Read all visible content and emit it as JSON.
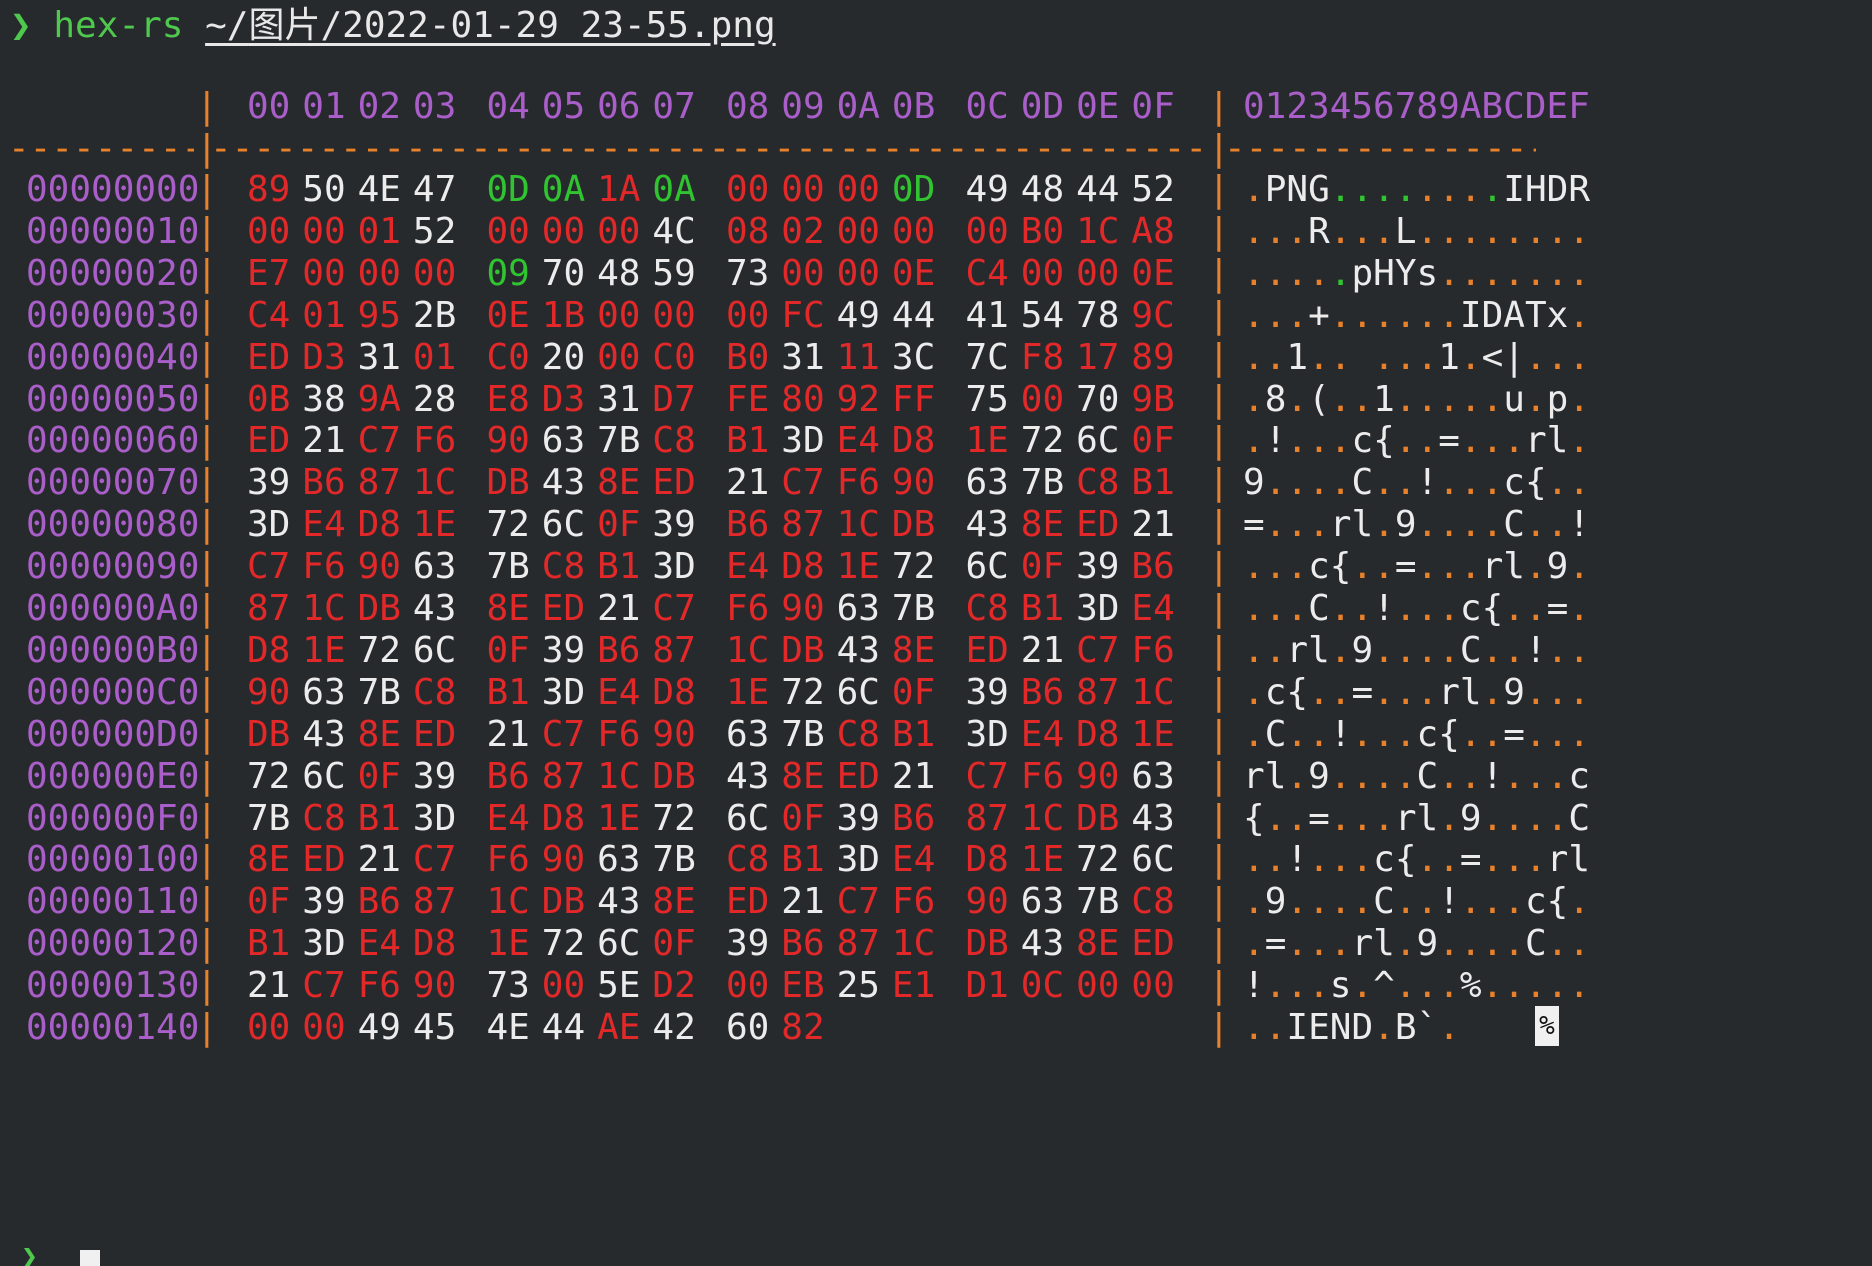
{
  "prompt": {
    "arrow": "❯",
    "command": "hex-rs",
    "path_prefix": "~/",
    "path_dir": "图片",
    "path_file": "/2022-01-29_23-55.png"
  },
  "header": {
    "columns": [
      "00",
      "01",
      "02",
      "03",
      "04",
      "05",
      "06",
      "07",
      "08",
      "09",
      "0A",
      "0B",
      "0C",
      "0D",
      "0E",
      "0F"
    ],
    "ascii_header": "0123456789ABCDEF",
    "separator": "|"
  },
  "dash_row": {
    "offset_dashes": "----------",
    "hex_dashes": "-------------------------------------------------------------------",
    "ascii_dashes": "-----------------"
  },
  "rows": [
    {
      "offset": "00000000",
      "bytes": [
        "89",
        "50",
        "4E",
        "47",
        "0D",
        "0A",
        "1A",
        "0A",
        "00",
        "00",
        "00",
        "0D",
        "49",
        "48",
        "44",
        "52"
      ],
      "ascii": ".PNG........IHDR"
    },
    {
      "offset": "00000010",
      "bytes": [
        "00",
        "00",
        "01",
        "52",
        "00",
        "00",
        "00",
        "4C",
        "08",
        "02",
        "00",
        "00",
        "00",
        "B0",
        "1C",
        "A8"
      ],
      "ascii": "...R...L........"
    },
    {
      "offset": "00000020",
      "bytes": [
        "E7",
        "00",
        "00",
        "00",
        "09",
        "70",
        "48",
        "59",
        "73",
        "00",
        "00",
        "0E",
        "C4",
        "00",
        "00",
        "0E"
      ],
      "ascii": ".....pHYs......."
    },
    {
      "offset": "00000030",
      "bytes": [
        "C4",
        "01",
        "95",
        "2B",
        "0E",
        "1B",
        "00",
        "00",
        "00",
        "FC",
        "49",
        "44",
        "41",
        "54",
        "78",
        "9C"
      ],
      "ascii": "...+......IDATx."
    },
    {
      "offset": "00000040",
      "bytes": [
        "ED",
        "D3",
        "31",
        "01",
        "C0",
        "20",
        "00",
        "C0",
        "B0",
        "31",
        "11",
        "3C",
        "7C",
        "F8",
        "17",
        "89"
      ],
      "ascii": "..1.. ...1.<|..."
    },
    {
      "offset": "00000050",
      "bytes": [
        "0B",
        "38",
        "9A",
        "28",
        "E8",
        "D3",
        "31",
        "D7",
        "FE",
        "80",
        "92",
        "FF",
        "75",
        "00",
        "70",
        "9B"
      ],
      "ascii": ".8.(..1.....u.p."
    },
    {
      "offset": "00000060",
      "bytes": [
        "ED",
        "21",
        "C7",
        "F6",
        "90",
        "63",
        "7B",
        "C8",
        "B1",
        "3D",
        "E4",
        "D8",
        "1E",
        "72",
        "6C",
        "0F"
      ],
      "ascii": ".!...c{..=...rl."
    },
    {
      "offset": "00000070",
      "bytes": [
        "39",
        "B6",
        "87",
        "1C",
        "DB",
        "43",
        "8E",
        "ED",
        "21",
        "C7",
        "F6",
        "90",
        "63",
        "7B",
        "C8",
        "B1"
      ],
      "ascii": "9....C..!...c{.."
    },
    {
      "offset": "00000080",
      "bytes": [
        "3D",
        "E4",
        "D8",
        "1E",
        "72",
        "6C",
        "0F",
        "39",
        "B6",
        "87",
        "1C",
        "DB",
        "43",
        "8E",
        "ED",
        "21"
      ],
      "ascii": "=...rl.9....C..!"
    },
    {
      "offset": "00000090",
      "bytes": [
        "C7",
        "F6",
        "90",
        "63",
        "7B",
        "C8",
        "B1",
        "3D",
        "E4",
        "D8",
        "1E",
        "72",
        "6C",
        "0F",
        "39",
        "B6"
      ],
      "ascii": "...c{..=...rl.9."
    },
    {
      "offset": "000000A0",
      "bytes": [
        "87",
        "1C",
        "DB",
        "43",
        "8E",
        "ED",
        "21",
        "C7",
        "F6",
        "90",
        "63",
        "7B",
        "C8",
        "B1",
        "3D",
        "E4"
      ],
      "ascii": "...C..!...c{..=."
    },
    {
      "offset": "000000B0",
      "bytes": [
        "D8",
        "1E",
        "72",
        "6C",
        "0F",
        "39",
        "B6",
        "87",
        "1C",
        "DB",
        "43",
        "8E",
        "ED",
        "21",
        "C7",
        "F6"
      ],
      "ascii": "..rl.9....C..!.."
    },
    {
      "offset": "000000C0",
      "bytes": [
        "90",
        "63",
        "7B",
        "C8",
        "B1",
        "3D",
        "E4",
        "D8",
        "1E",
        "72",
        "6C",
        "0F",
        "39",
        "B6",
        "87",
        "1C"
      ],
      "ascii": ".c{..=...rl.9..."
    },
    {
      "offset": "000000D0",
      "bytes": [
        "DB",
        "43",
        "8E",
        "ED",
        "21",
        "C7",
        "F6",
        "90",
        "63",
        "7B",
        "C8",
        "B1",
        "3D",
        "E4",
        "D8",
        "1E"
      ],
      "ascii": ".C..!...c{..=..."
    },
    {
      "offset": "000000E0",
      "bytes": [
        "72",
        "6C",
        "0F",
        "39",
        "B6",
        "87",
        "1C",
        "DB",
        "43",
        "8E",
        "ED",
        "21",
        "C7",
        "F6",
        "90",
        "63"
      ],
      "ascii": "rl.9....C..!...c"
    },
    {
      "offset": "000000F0",
      "bytes": [
        "7B",
        "C8",
        "B1",
        "3D",
        "E4",
        "D8",
        "1E",
        "72",
        "6C",
        "0F",
        "39",
        "B6",
        "87",
        "1C",
        "DB",
        "43"
      ],
      "ascii": "{..=...rl.9....C"
    },
    {
      "offset": "00000100",
      "bytes": [
        "8E",
        "ED",
        "21",
        "C7",
        "F6",
        "90",
        "63",
        "7B",
        "C8",
        "B1",
        "3D",
        "E4",
        "D8",
        "1E",
        "72",
        "6C"
      ],
      "ascii": "..!...c{..=...rl"
    },
    {
      "offset": "00000110",
      "bytes": [
        "0F",
        "39",
        "B6",
        "87",
        "1C",
        "DB",
        "43",
        "8E",
        "ED",
        "21",
        "C7",
        "F6",
        "90",
        "63",
        "7B",
        "C8"
      ],
      "ascii": ".9....C..!...c{."
    },
    {
      "offset": "00000120",
      "bytes": [
        "B1",
        "3D",
        "E4",
        "D8",
        "1E",
        "72",
        "6C",
        "0F",
        "39",
        "B6",
        "87",
        "1C",
        "DB",
        "43",
        "8E",
        "ED"
      ],
      "ascii": ".=...rl.9....C.."
    },
    {
      "offset": "00000130",
      "bytes": [
        "21",
        "C7",
        "F6",
        "90",
        "73",
        "00",
        "5E",
        "D2",
        "00",
        "EB",
        "25",
        "E1",
        "D1",
        "0C",
        "00",
        "00"
      ],
      "ascii": "!...s.^...%....."
    },
    {
      "offset": "00000140",
      "bytes": [
        "00",
        "00",
        "49",
        "45",
        "4E",
        "44",
        "AE",
        "42",
        "60",
        "82"
      ],
      "ascii": "..IEND.B`."
    }
  ],
  "end_marker": "%",
  "colors": {
    "background": "#272a2d",
    "offset": "#a95ec9",
    "separator": "#e8812a",
    "nonprint": "#e22828",
    "whitespace": "#31c431",
    "printable": "#ececec",
    "prompt": "#4ec94e"
  }
}
